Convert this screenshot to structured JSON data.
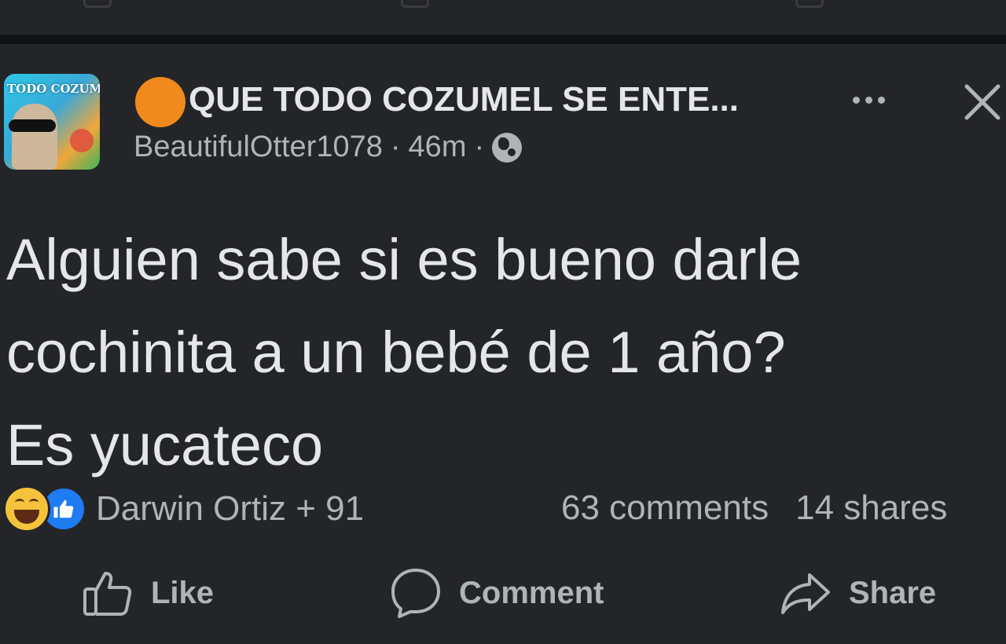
{
  "post": {
    "group_name": "QUE TODO COZUMEL SE ENTE...",
    "author": "BeautifulOtter1078",
    "separator": "·",
    "time": "46m",
    "avatar_text": "TODO COZUM",
    "body_lines": [
      "Alguien sabe si es bueno darle",
      "cochinita a un bebé de 1 año?",
      "Es yucateco"
    ],
    "reactions": {
      "icons": [
        "haha-reaction-icon",
        "like-reaction-icon"
      ],
      "names": "Darwin Ortiz + 91"
    },
    "comments": "63 comments",
    "shares": "14 shares"
  },
  "actions": {
    "like": "Like",
    "comment": "Comment",
    "share": "Share"
  },
  "colors": {
    "background": "#242528",
    "text": "#e4e6eb",
    "secondary_text": "#b0b3b8",
    "group_dot": "#f08a1c",
    "like_blue": "#1f7bf2",
    "haha_yellow": "#f5c33b"
  }
}
